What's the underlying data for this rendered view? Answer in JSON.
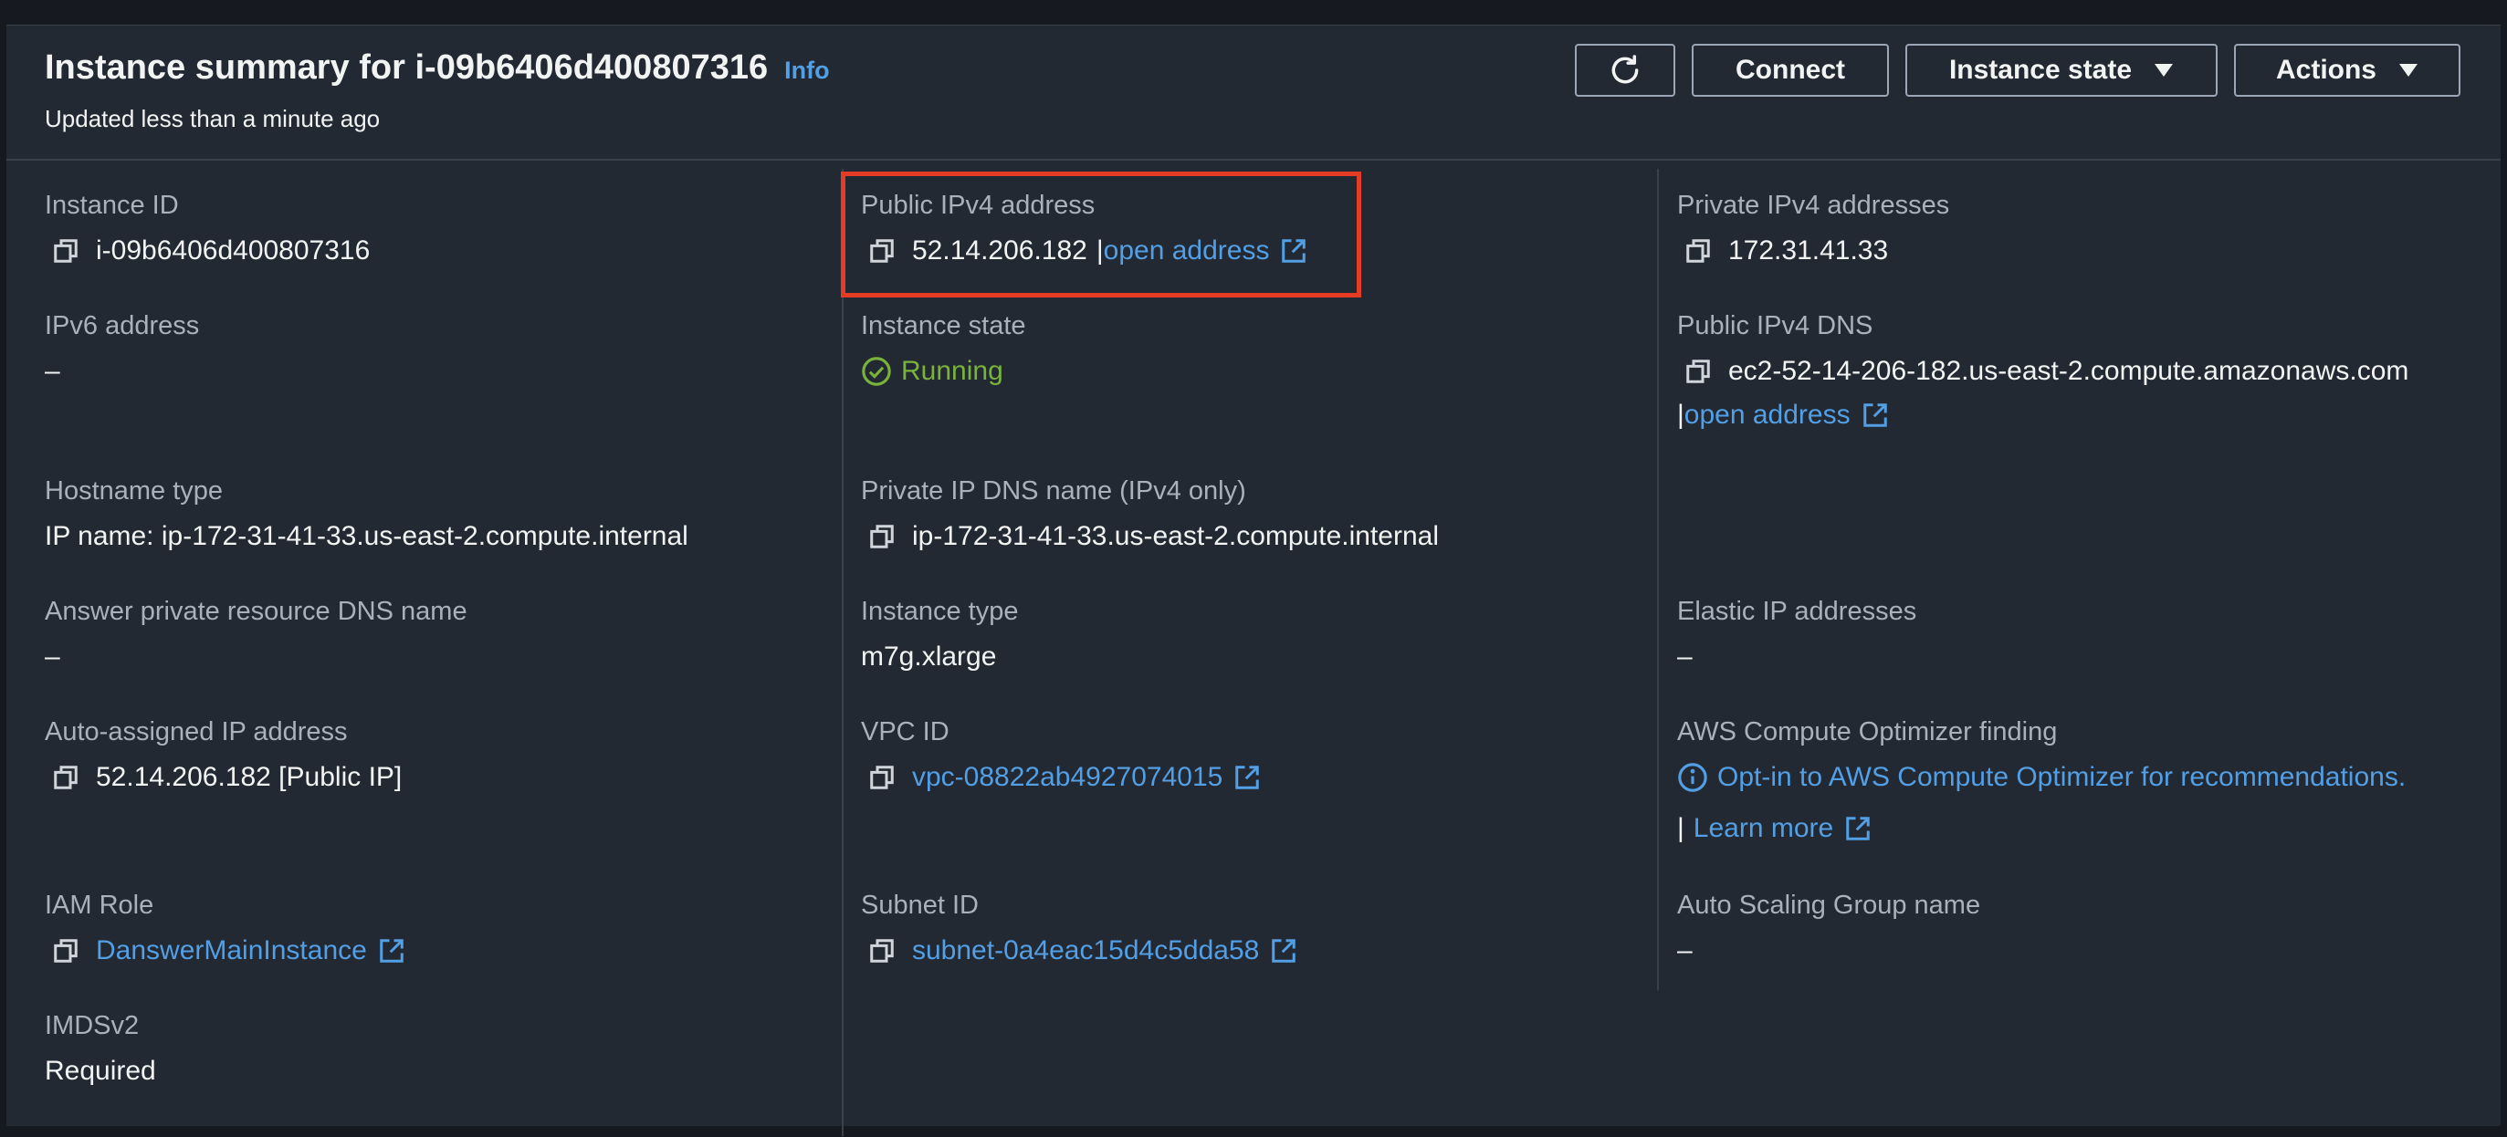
{
  "header": {
    "title": "Instance summary for i-09b6406d400807316",
    "info_label": "Info",
    "subtitle": "Updated less than a minute ago",
    "refresh_icon": "refresh-icon",
    "connect_label": "Connect",
    "instance_state_label": "Instance state",
    "actions_label": "Actions"
  },
  "col1": {
    "instance_id": {
      "label": "Instance ID",
      "value": "i-09b6406d400807316"
    },
    "ipv6": {
      "label": "IPv6 address",
      "value": "–"
    },
    "hostname_type": {
      "label": "Hostname type",
      "value": "IP name: ip-172-31-41-33.us-east-2.compute.internal"
    },
    "answer_dns": {
      "label": "Answer private resource DNS name",
      "value": "–"
    },
    "auto_ip": {
      "label": "Auto-assigned IP address",
      "value": "52.14.206.182 [Public IP]"
    },
    "iam_role": {
      "label": "IAM Role",
      "value": "DanswerMainInstance"
    },
    "imdsv2": {
      "label": "IMDSv2",
      "value": "Required"
    }
  },
  "col2": {
    "public_ipv4": {
      "label": "Public IPv4 address",
      "value": "52.14.206.182",
      "separator": "|",
      "link": "open address"
    },
    "instance_state": {
      "label": "Instance state",
      "value": "Running"
    },
    "private_dns": {
      "label": "Private IP DNS name (IPv4 only)",
      "value": "ip-172-31-41-33.us-east-2.compute.internal"
    },
    "instance_type": {
      "label": "Instance type",
      "value": "m7g.xlarge"
    },
    "vpc_id": {
      "label": "VPC ID",
      "value": "vpc-08822ab4927074015"
    },
    "subnet_id": {
      "label": "Subnet ID",
      "value": "subnet-0a4eac15d4c5dda58"
    }
  },
  "col3": {
    "private_ipv4": {
      "label": "Private IPv4 addresses",
      "value": "172.31.41.33"
    },
    "public_dns": {
      "label": "Public IPv4 DNS",
      "value": "ec2-52-14-206-182.us-east-2.compute.amazonaws.com",
      "separator": "|",
      "link": "open address"
    },
    "elastic_ip": {
      "label": "Elastic IP addresses",
      "value": "–"
    },
    "optimizer": {
      "label": "AWS Compute Optimizer finding",
      "link": "Opt-in to AWS Compute Optimizer for recommendations.",
      "separator": "|",
      "learn_more": "Learn more"
    },
    "asg": {
      "label": "Auto Scaling Group name",
      "value": "–"
    }
  },
  "colors": {
    "background": "#232932",
    "link": "#539fe5",
    "running": "#7ab33b",
    "highlight": "#e63b24"
  }
}
